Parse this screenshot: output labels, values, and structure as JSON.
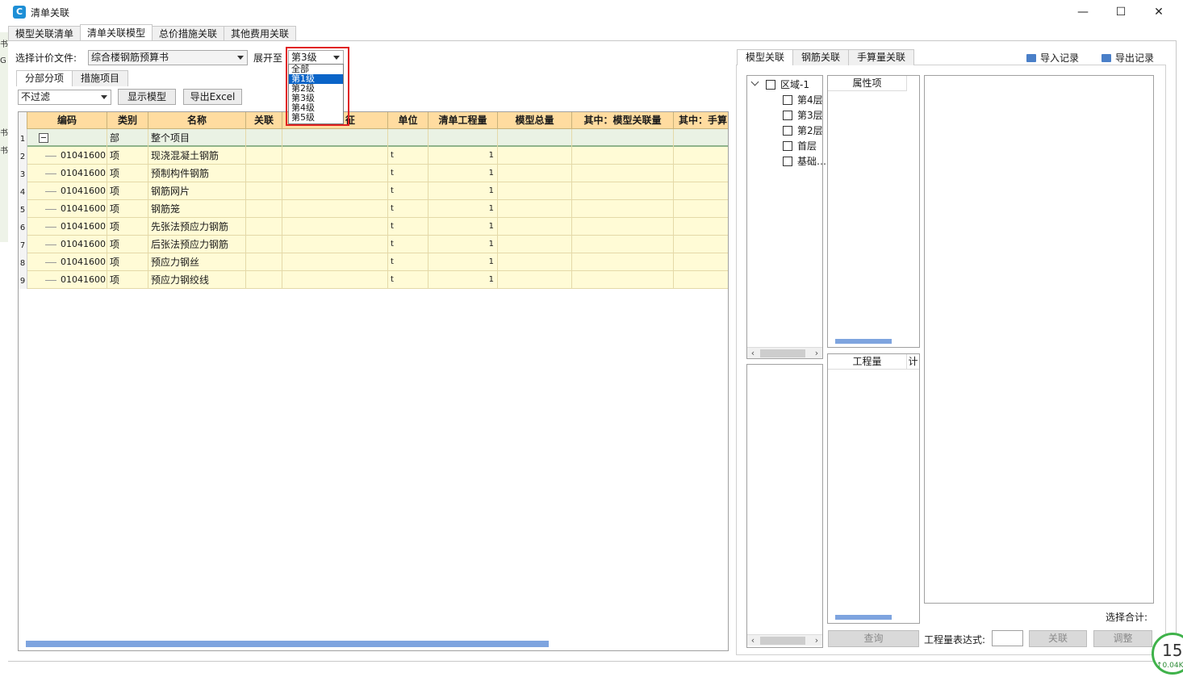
{
  "window": {
    "title": "清单关联",
    "minimize": "—",
    "maximize": "☐",
    "close": "✕"
  },
  "main_tabs": [
    "模型关联清单",
    "清单关联模型",
    "总价措施关联",
    "其他费用关联"
  ],
  "toolbar": {
    "file_label": "选择计价文件:",
    "file_value": "综合楼钢筋预算书",
    "expand_label": "展开至",
    "expand_value": "第3级",
    "expand_options": [
      "全部",
      "第1级",
      "第2级",
      "第3级",
      "第4级",
      "第5级"
    ],
    "filter_value": "不过滤",
    "show_model": "显示模型",
    "export_excel": "导出Excel"
  },
  "sub_tabs": [
    "分部分项",
    "措施项目"
  ],
  "grid": {
    "columns": [
      "编码",
      "类别",
      "名称",
      "关联",
      "征",
      "单位",
      "清单工程量",
      "模型总量",
      "其中：模型关联量",
      "其中：手算"
    ],
    "rows": [
      {
        "num": "1",
        "code": "",
        "type": "部",
        "name": "整个项目",
        "unit": "",
        "qty": ""
      },
      {
        "num": "2",
        "code": "01041600…",
        "type": "项",
        "name": "现浇混凝土钢筋",
        "unit": "t",
        "qty": "1"
      },
      {
        "num": "3",
        "code": "01041600…",
        "type": "项",
        "name": "预制构件钢筋",
        "unit": "t",
        "qty": "1"
      },
      {
        "num": "4",
        "code": "01041600…",
        "type": "项",
        "name": "钢筋网片",
        "unit": "t",
        "qty": "1"
      },
      {
        "num": "5",
        "code": "01041600…",
        "type": "项",
        "name": "钢筋笼",
        "unit": "t",
        "qty": "1"
      },
      {
        "num": "6",
        "code": "01041600…",
        "type": "项",
        "name": "先张法预应力钢筋",
        "unit": "t",
        "qty": "1"
      },
      {
        "num": "7",
        "code": "01041600…",
        "type": "项",
        "name": "后张法预应力钢筋",
        "unit": "t",
        "qty": "1"
      },
      {
        "num": "8",
        "code": "01041600…",
        "type": "项",
        "name": "预应力钢丝",
        "unit": "t",
        "qty": "1"
      },
      {
        "num": "9",
        "code": "01041600…",
        "type": "项",
        "name": "预应力钢绞线",
        "unit": "t",
        "qty": "1"
      }
    ]
  },
  "right": {
    "tabs": [
      "模型关联",
      "钢筋关联",
      "手算量关联"
    ],
    "import": "导入记录",
    "export": "导出记录",
    "tree": {
      "root": "区域-1",
      "children": [
        "第4层",
        "第3层",
        "第2层",
        "首层",
        "基础…"
      ]
    },
    "attr_header": "属性项",
    "qty_header": "工程量",
    "qty_header_extra": "计",
    "query_btn": "查询",
    "expr_label": "工程量表达式:",
    "link_btn": "关联",
    "adjust_btn": "调整",
    "sum_label": "选择合计:"
  },
  "left_strip": [
    "书",
    "G",
    "书",
    "书"
  ],
  "badge": {
    "num": "15",
    "sub": "↑0.04K"
  }
}
